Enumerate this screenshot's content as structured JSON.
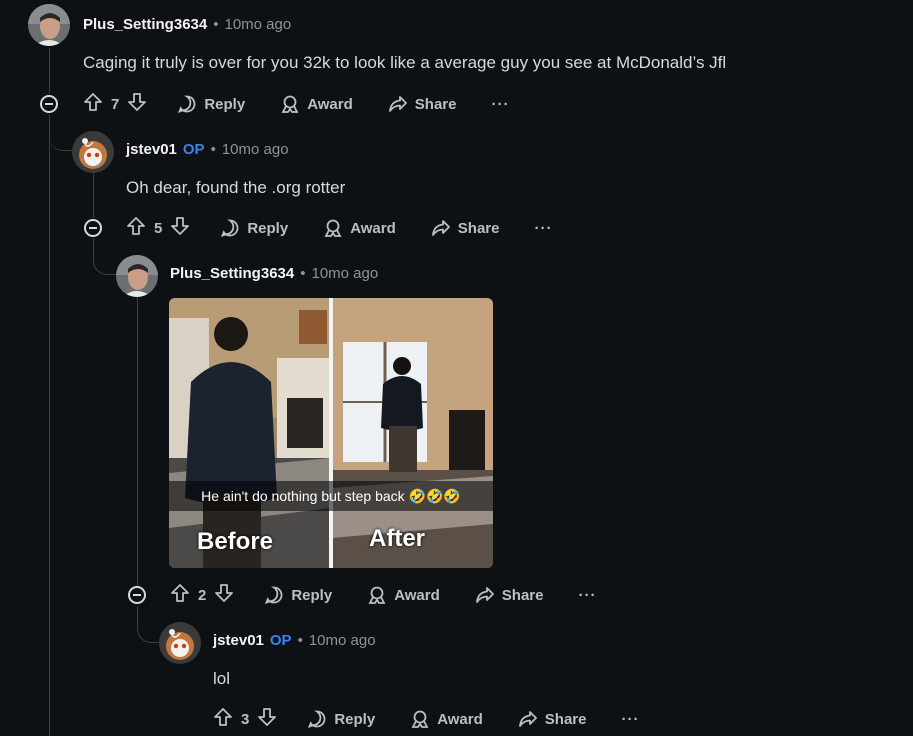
{
  "comments": [
    {
      "author": "Plus_Setting3634",
      "time": "10mo ago",
      "body": "Caging it truly is over for you 32k to look like a average guy you see at McDonald’s Jfl",
      "votes": "7"
    },
    {
      "author": "jstev01",
      "op_badge": "OP",
      "time": "10mo ago",
      "body": "Oh dear, found the .org rotter",
      "votes": "5"
    },
    {
      "author": "Plus_Setting3634",
      "time": "10mo ago",
      "image": {
        "caption": "He ain't do nothing but step back 🤣🤣🤣",
        "label_left": "Before",
        "label_right": "After"
      },
      "votes": "2"
    },
    {
      "author": "jstev01",
      "op_badge": "OP",
      "time": "10mo ago",
      "body": "lol",
      "votes": "3"
    }
  ],
  "actions": {
    "reply": "Reply",
    "award": "Award",
    "share": "Share",
    "more": "···",
    "separator": "•"
  },
  "colors": {
    "background": "#0e1113",
    "op_badge": "#3b82f6",
    "thread_line": "#3a3f42"
  }
}
